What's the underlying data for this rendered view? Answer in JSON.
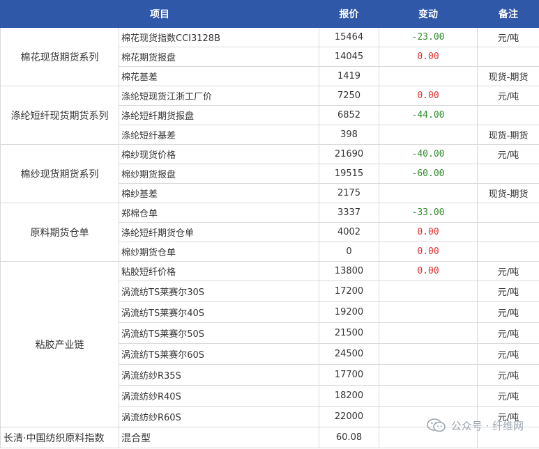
{
  "header": {
    "item": "项目",
    "price": "报价",
    "change": "变动",
    "note": "备注"
  },
  "groups": [
    {
      "name": "棉花现货期货系列",
      "rows": [
        {
          "item": "棉花现货指数CCI3128B",
          "price": "15464",
          "change": "-23.00",
          "note": "元/吨"
        },
        {
          "item": "棉花期货报盘",
          "price": "14045",
          "change": "0.00",
          "note": ""
        },
        {
          "item": "棉花基差",
          "price": "1419",
          "change": "",
          "note": "现货-期货"
        }
      ]
    },
    {
      "name": "涤纶短纤现货期货系列",
      "rows": [
        {
          "item": "涤纶短现货江浙工厂价",
          "price": "7250",
          "change": "0.00",
          "note": "元/吨"
        },
        {
          "item": "涤纶短纤期货报盘",
          "price": "6852",
          "change": "-44.00",
          "note": ""
        },
        {
          "item": "涤纶短纤基差",
          "price": "398",
          "change": "",
          "note": "现货-期货"
        }
      ]
    },
    {
      "name": "棉纱现货期货系列",
      "rows": [
        {
          "item": "棉纱现货价格",
          "price": "21690",
          "change": "-40.00",
          "note": "元/吨"
        },
        {
          "item": "棉纱期货报盘",
          "price": "19515",
          "change": "-60.00",
          "note": ""
        },
        {
          "item": "棉纱基差",
          "price": "2175",
          "change": "",
          "note": "现货-期货"
        }
      ]
    },
    {
      "name": "原料期货仓单",
      "rows": [
        {
          "item": "郑棉仓单",
          "price": "3337",
          "change": "-33.00",
          "note": ""
        },
        {
          "item": "涤纶短纤期货仓单",
          "price": "4002",
          "change": "0.00",
          "note": ""
        },
        {
          "item": "棉纱期货仓单",
          "price": "0",
          "change": "0.00",
          "note": ""
        }
      ]
    },
    {
      "name": "粘胶产业链",
      "rows": [
        {
          "item": "粘胶短纤价格",
          "price": "13800",
          "change": "0.00",
          "note": "元/吨"
        },
        {
          "item": "涡流纺TS莱赛尔30S",
          "price": "17200",
          "change": "",
          "note": "元/吨"
        },
        {
          "item": "涡流纺TS莱赛尔40S",
          "price": "19200",
          "change": "",
          "note": "元/吨"
        },
        {
          "item": "涡流纺TS莱赛尔50S",
          "price": "21500",
          "change": "",
          "note": "元/吨"
        },
        {
          "item": "涡流纺TS莱赛尔60S",
          "price": "24500",
          "change": "",
          "note": "元/吨"
        },
        {
          "item": "涡流纺纱R35S",
          "price": "17700",
          "change": "",
          "note": "元/吨"
        },
        {
          "item": "涡流纺纱R40S",
          "price": "18200",
          "change": "",
          "note": "元/吨"
        },
        {
          "item": "涡流纺纱R60S",
          "price": "22000",
          "change": "",
          "note": "元/吨"
        }
      ]
    }
  ],
  "footer": {
    "label": "长清·中国纺织原料指数",
    "item": "混合型",
    "price": "60.08"
  },
  "watermark": {
    "text": "公众号 · 纤维网"
  },
  "colors": {
    "header_bg": "#2f58a8",
    "negative": "#2e8b2e",
    "zero": "#e03030"
  }
}
